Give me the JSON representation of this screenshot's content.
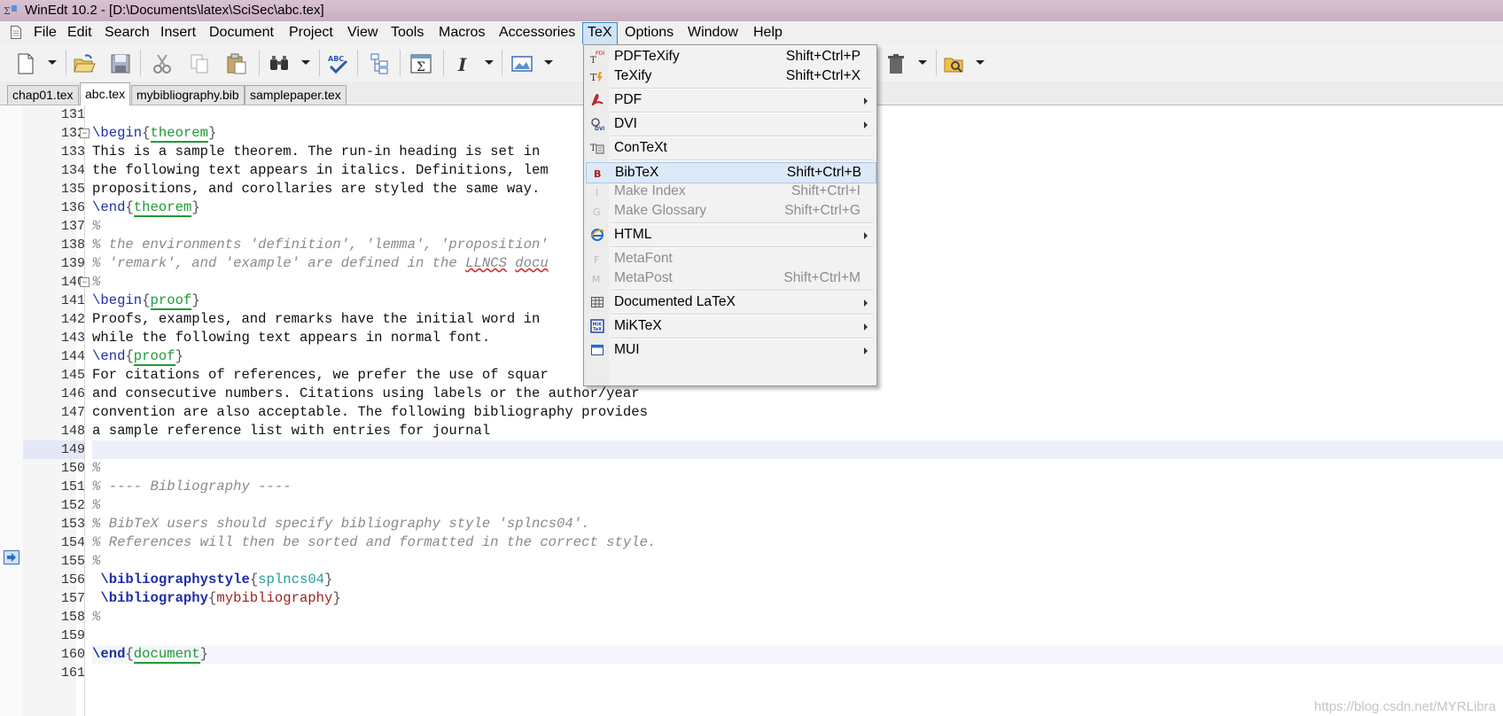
{
  "window": {
    "title": "WinEdt 10.2 - [D:\\Documents\\latex\\SciSec\\abc.tex]"
  },
  "menubar": {
    "items": [
      "File",
      "Edit",
      "Search",
      "Insert",
      "Document",
      "Project",
      "View",
      "Tools",
      "Macros",
      "Accessories",
      "TeX",
      "Options",
      "Window",
      "Help"
    ],
    "active": "TeX"
  },
  "toolbar": {
    "buttons": [
      "new-icon",
      "open-folder-icon",
      "save-icon",
      "cut-icon",
      "copy-icon",
      "paste-icon",
      "find-icon",
      "spellcheck-icon",
      "tree-icon",
      "sigma-icon",
      "italic-icon",
      "image-icon",
      "delete-icon",
      "preview-folder-icon"
    ]
  },
  "tabs": [
    {
      "label": "chap01.tex"
    },
    {
      "label": "abc.tex",
      "active": true
    },
    {
      "label": "mybibliography.bib"
    },
    {
      "label": "samplepaper.tex"
    }
  ],
  "editor": {
    "current_line": 149,
    "lines": [
      {
        "n": "131"
      },
      {
        "n": "132"
      },
      {
        "n": "133"
      },
      {
        "n": "134"
      },
      {
        "n": "135"
      },
      {
        "n": "136"
      },
      {
        "n": "137"
      },
      {
        "n": "138"
      },
      {
        "n": "139"
      },
      {
        "n": "140"
      },
      {
        "n": "141"
      },
      {
        "n": "142"
      },
      {
        "n": "143"
      },
      {
        "n": "144"
      },
      {
        "n": "145"
      },
      {
        "n": "146"
      },
      {
        "n": "147"
      },
      {
        "n": "148"
      },
      {
        "n": "149"
      },
      {
        "n": "150"
      },
      {
        "n": "151"
      },
      {
        "n": "152"
      },
      {
        "n": "153"
      },
      {
        "n": "154"
      },
      {
        "n": "155"
      },
      {
        "n": "156"
      },
      {
        "n": "157"
      },
      {
        "n": "158"
      },
      {
        "n": "159"
      },
      {
        "n": "160"
      },
      {
        "n": "161"
      }
    ],
    "text": {
      "l132_cmd": "\\begin",
      "l132_env": "theorem",
      "l133": "This is a sample theorem. The run-in heading is set in",
      "l134": "the following text appears in italics. Definitions, lem",
      "l135": "propositions, and corollaries are styled the same way.",
      "l136_cmd": "\\end",
      "l136_env": "theorem",
      "l137": "%",
      "l138": "% the environments 'definition', 'lemma', 'proposition'",
      "l139a": "% 'remark', and 'example' are defined in the ",
      "l139b": "LLNCS",
      "l139c": " ",
      "l139d": "docu",
      "l140": "%",
      "l141_cmd": "\\begin",
      "l141_env": "proof",
      "l142": "Proofs, examples, and remarks have the initial word in",
      "l143": "while the following text appears in normal font.",
      "l144_cmd": "\\end",
      "l144_env": "proof",
      "l145": "For citations of references, we prefer the use of squar",
      "l146": "and consecutive numbers. Citations using labels or the author/year",
      "l147": "convention are also acceptable. The following bibliography provides",
      "l148": "a sample reference list with entries for journal",
      "l150": "%",
      "l151": "% ---- Bibliography ----",
      "l152": "%",
      "l153": "% BibTeX users should specify bibliography style 'splncs04'.",
      "l154": "% References will then be sorted and formatted in the correct style.",
      "l155": "%",
      "l156_cmd": "\\bibliographystyle",
      "l156_arg": "splncs04",
      "l157_cmd": "\\bibliography",
      "l157_arg": "mybibliography",
      "l158": "%",
      "l160_cmd": "\\end",
      "l160_env": "document"
    }
  },
  "tex_menu": {
    "items": [
      {
        "label": "PDFTeXify",
        "shortcut": "Shift+Ctrl+P",
        "icon": "pdftexify-icon"
      },
      {
        "label": "TeXify",
        "shortcut": "Shift+Ctrl+X",
        "icon": "texify-icon"
      },
      {
        "label": "PDF",
        "submenu": true,
        "icon": "pdf-icon"
      },
      {
        "label": "DVI",
        "submenu": true,
        "icon": "dvi-icon"
      },
      {
        "label": "ConTeXt",
        "icon": "context-icon"
      },
      {
        "label": "BibTeX",
        "shortcut": "Shift+Ctrl+B",
        "icon": "bibtex-icon",
        "selected": true
      },
      {
        "label": "Make Index",
        "shortcut": "Shift+Ctrl+I",
        "icon": "makeindex-icon",
        "disabled": true
      },
      {
        "label": "Make Glossary",
        "shortcut": "Shift+Ctrl+G",
        "icon": "makeglossary-icon",
        "disabled": true
      },
      {
        "label": "HTML",
        "submenu": true,
        "icon": "html-icon"
      },
      {
        "label": "MetaFont",
        "icon": "metafont-icon",
        "disabled": true
      },
      {
        "label": "MetaPost",
        "shortcut": "Shift+Ctrl+M",
        "icon": "metapost-icon",
        "disabled": true
      },
      {
        "label": "Documented LaTeX",
        "submenu": true,
        "icon": "grid-icon"
      },
      {
        "label": "MiKTeX",
        "submenu": true,
        "icon": "miktex-icon"
      },
      {
        "label": "MUI",
        "submenu": true,
        "icon": "window-icon"
      }
    ],
    "icon_letters": {
      "bibtex": "B",
      "makeindex": "I",
      "makeglossary": "G",
      "metafont": "F",
      "metapost": "M"
    }
  },
  "watermark": "https://blog.csdn.net/MYRLibra",
  "colors": {
    "accent": "#3b86c8",
    "command": "#1f2fa8",
    "environment": "#1e9b35",
    "comment": "#8a8a8a",
    "argument": "#9e1f1f"
  }
}
